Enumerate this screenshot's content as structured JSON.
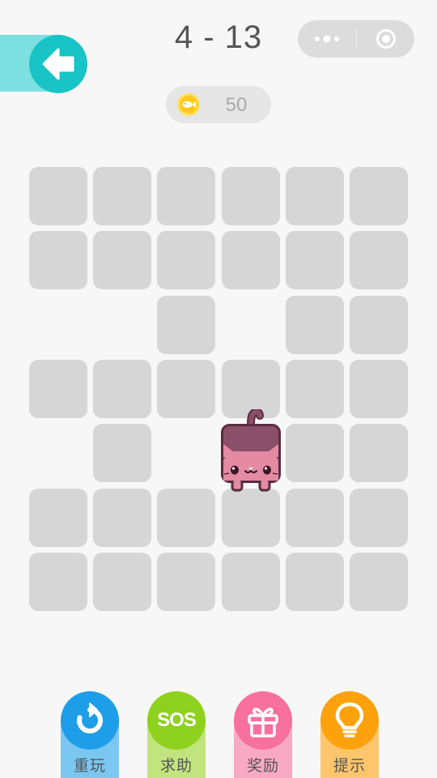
{
  "header": {
    "level": "4 - 13",
    "back_icon": "arrow-left-icon",
    "capsule": {
      "more_icon": "more-dots-icon",
      "close_icon": "target-circle-icon"
    }
  },
  "coins": {
    "icon": "fish-coin-icon",
    "count": "50"
  },
  "board": {
    "cols": 6,
    "rows": 7,
    "layout": [
      "XXXXXX",
      "XXXXXX",
      "..X.XX",
      "XXXXXX",
      ".X.CXX",
      "XXXXXX",
      "XXXXXX"
    ],
    "cat_cell": {
      "row": 5,
      "col": 4
    }
  },
  "actions": [
    {
      "id": "replay",
      "label": "重玩",
      "icon": "replay-icon",
      "color": "#1e9ee8",
      "stem": "#7ac7f2"
    },
    {
      "id": "sos",
      "label": "求助",
      "icon": "sos-icon",
      "icon_text": "SOS",
      "color": "#8ed11e",
      "stem": "#c2e47e"
    },
    {
      "id": "reward",
      "label": "奖励",
      "icon": "gift-icon",
      "color": "#f7709e",
      "stem": "#f9a9c4"
    },
    {
      "id": "hint",
      "label": "提示",
      "icon": "lightbulb-icon",
      "color": "#fda20c",
      "stem": "#fdc56c"
    }
  ],
  "colors": {
    "background": "#f7f7f7",
    "cell": "#d6d6d6",
    "back_button": "#18c4c6",
    "back_tab": "#7de0e0",
    "cat_body": "#8b5069",
    "cat_face": "#e48aa3"
  }
}
